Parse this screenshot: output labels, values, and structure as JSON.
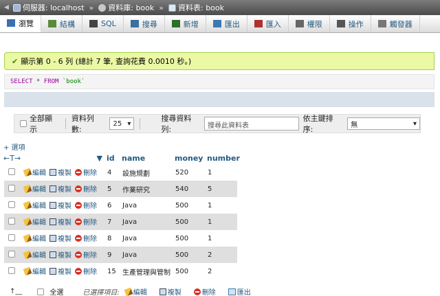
{
  "breadcrumb": {
    "server": "伺服器: localhost",
    "database": "資料庫: book",
    "table": "資料表: book"
  },
  "tabs": [
    {
      "label": "瀏覽",
      "icon": "browse-icon"
    },
    {
      "label": "結構",
      "icon": "structure-icon"
    },
    {
      "label": "SQL",
      "icon": "sql-icon"
    },
    {
      "label": "搜尋",
      "icon": "search-icon"
    },
    {
      "label": "新增",
      "icon": "insert-icon"
    },
    {
      "label": "匯出",
      "icon": "export-icon"
    },
    {
      "label": "匯入",
      "icon": "import-icon"
    },
    {
      "label": "權限",
      "icon": "privileges-icon"
    },
    {
      "label": "操作",
      "icon": "operations-icon"
    },
    {
      "label": "觸發器",
      "icon": "triggers-icon"
    }
  ],
  "message": {
    "text": "顯示第 0 - 6 列 (總計 7 筆, 查詢花費 0.0010 秒。)"
  },
  "sql": {
    "select": "SELECT",
    "star": " * ",
    "from": "FROM",
    "table": " `book`"
  },
  "nav": {
    "show_all": "全部顯示",
    "rows_label": "資料列數:",
    "rows_value": "25",
    "search_label": "搜尋資料列:",
    "search_placeholder": "搜尋此資料表",
    "sort_label": "依主鍵排序:",
    "sort_value": "無"
  },
  "options_label": "+ 選項",
  "header_arrows": "←T→",
  "columns": [
    "id",
    "name",
    "money",
    "number"
  ],
  "actions": {
    "edit": "編輯",
    "copy": "複製",
    "delete": "刪除"
  },
  "rows": [
    {
      "id": "4",
      "name": "設施規劃",
      "money": "520",
      "number": "1"
    },
    {
      "id": "5",
      "name": "作業研究",
      "money": "540",
      "number": "5"
    },
    {
      "id": "6",
      "name": "Java",
      "money": "500",
      "number": "1"
    },
    {
      "id": "7",
      "name": "Java",
      "money": "500",
      "number": "1"
    },
    {
      "id": "8",
      "name": "Java",
      "money": "500",
      "number": "1"
    },
    {
      "id": "9",
      "name": "Java",
      "money": "500",
      "number": "2"
    },
    {
      "id": "15",
      "name": "生產管理與管制",
      "money": "500",
      "number": "2"
    }
  ],
  "footer": {
    "select_all": "全選",
    "with_selected": "已選擇項目:",
    "edit": "編輯",
    "copy": "複製",
    "delete": "刪除",
    "export": "匯出"
  }
}
